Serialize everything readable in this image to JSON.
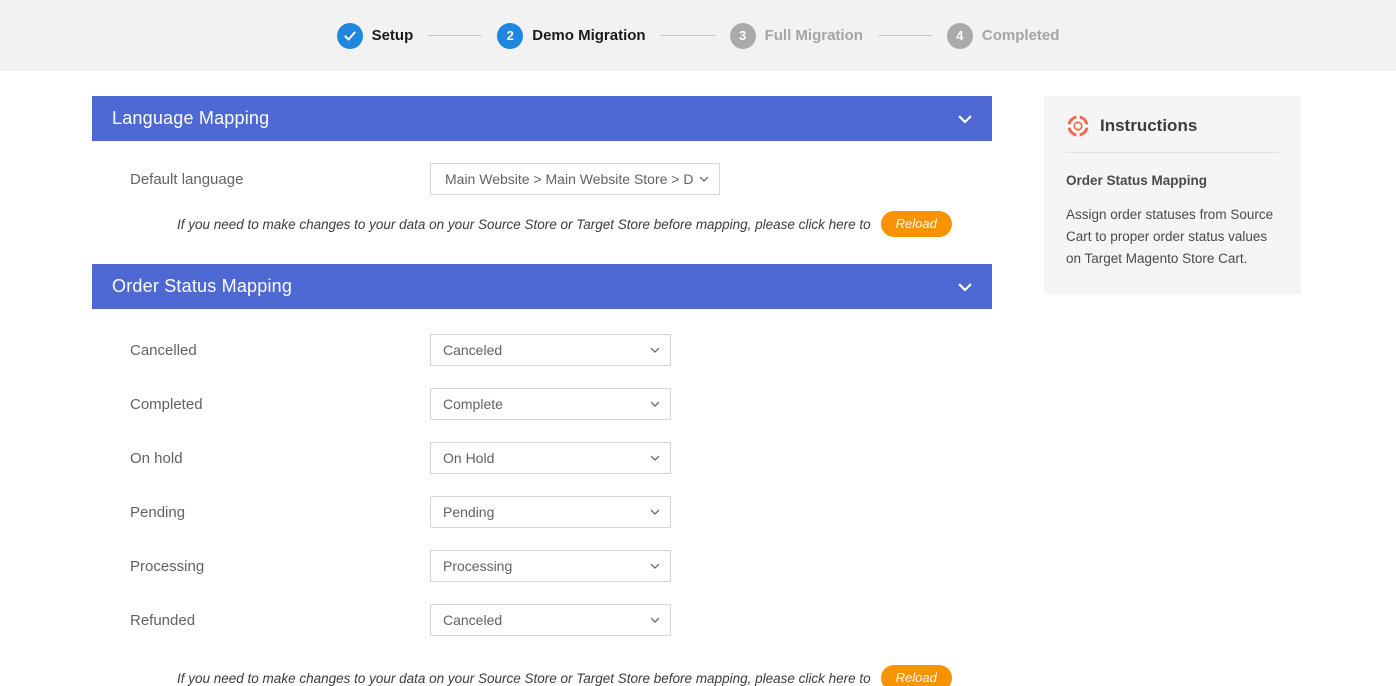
{
  "stepper": {
    "steps": [
      {
        "id": "setup",
        "marker": "check",
        "label": "Setup",
        "state": "done"
      },
      {
        "id": "demo-migration",
        "marker": "2",
        "label": "Demo Migration",
        "state": "active"
      },
      {
        "id": "full-migration",
        "marker": "3",
        "label": "Full Migration",
        "state": "idle"
      },
      {
        "id": "completed",
        "marker": "4",
        "label": "Completed",
        "state": "idle"
      }
    ]
  },
  "language_mapping": {
    "title": "Language Mapping",
    "collapse_icon": "chevron-down-icon",
    "row": {
      "label": "Default language",
      "value": "Main Website > Main Website Store > Default Store View"
    },
    "note": {
      "text": "If you need to make changes to your data on your Source Store or Target Store before mapping, please click here to",
      "button_label": "Reload"
    }
  },
  "order_status_mapping": {
    "title": "Order Status Mapping",
    "collapse_icon": "chevron-down-icon",
    "rows": [
      {
        "label": "Cancelled",
        "value": "Canceled"
      },
      {
        "label": "Completed",
        "value": "Complete"
      },
      {
        "label": "On hold",
        "value": "On Hold"
      },
      {
        "label": "Pending",
        "value": "Pending"
      },
      {
        "label": "Processing",
        "value": "Processing"
      },
      {
        "label": "Refunded",
        "value": "Canceled"
      }
    ],
    "note": {
      "text": "If you need to make changes to your data on your Source Store or Target Store before mapping, please click here to",
      "button_label": "Reload"
    }
  },
  "instructions": {
    "icon": "lifebuoy-icon",
    "title": "Instructions",
    "subtitle": "Order Status Mapping",
    "body": "Assign order statuses from Source Cart to proper order status values on Target Magento Store Cart."
  },
  "colors": {
    "panel_header": "#4e69d4",
    "step_active": "#1f87e0",
    "step_idle": "#aaaaaa",
    "reload_button": "#f79200",
    "lifebuoy": "#f4644b",
    "stepper_bg": "#f2f2f2",
    "instructions_bg": "#f5f5f5"
  }
}
